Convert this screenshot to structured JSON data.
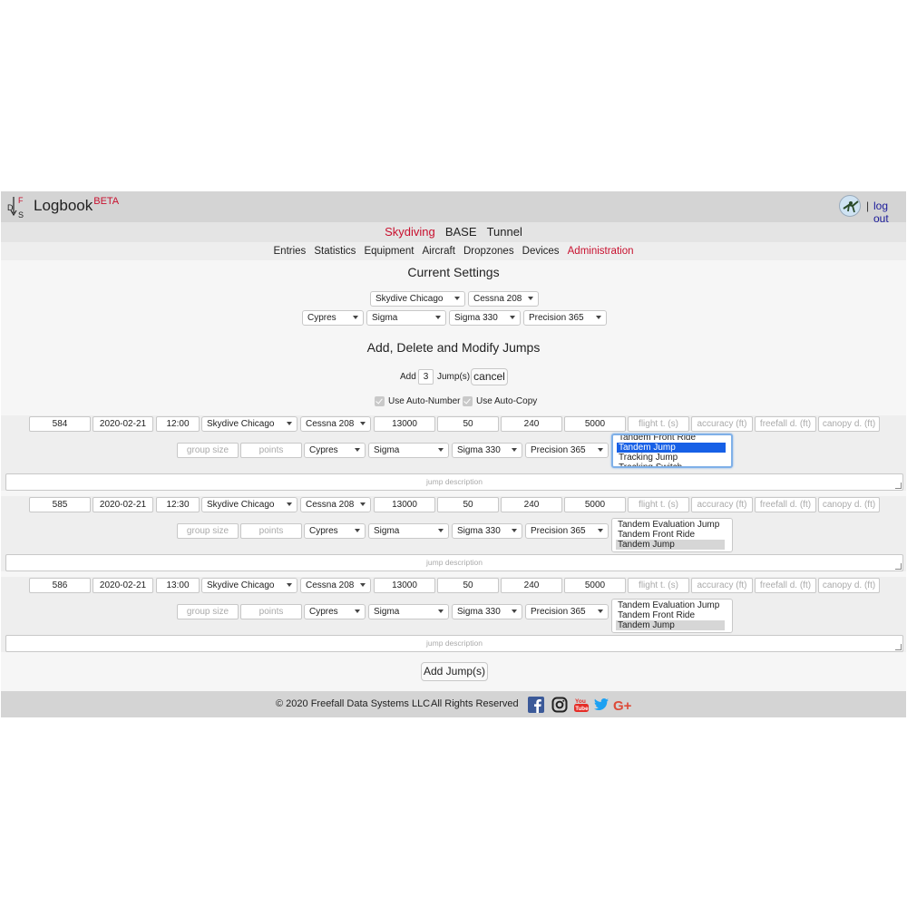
{
  "header": {
    "brand": "Logbook",
    "brand_sup": "BETA",
    "separator": "|",
    "logout_label": "log out"
  },
  "sport_tabs": [
    "Skydiving",
    "BASE",
    "Tunnel"
  ],
  "nav_tabs": [
    "Entries",
    "Statistics",
    "Equipment",
    "Aircraft",
    "Dropzones",
    "Devices",
    "Administration"
  ],
  "current_settings": {
    "title": "Current Settings",
    "dropzone": "Skydive Chicago",
    "aircraft": "Cessna 208",
    "aad": "Cypres",
    "container": "Sigma",
    "main": "Sigma 330",
    "reserve": "Precision 365"
  },
  "jumps_section": {
    "title": "Add, Delete and Modify Jumps",
    "add_label": "Add",
    "add_count": "3",
    "jumps_label": "Jump(s)",
    "cancel_label": "cancel",
    "auto_number_label": "Use Auto-Number",
    "auto_copy_label": "Use Auto-Copy",
    "add_button_label": "Add Jump(s)"
  },
  "placeholders": {
    "flight_time": "flight t. (s)",
    "accuracy": "accuracy (ft)",
    "freefall": "freefall d. (ft)",
    "canopy": "canopy d. (ft)",
    "group_size": "group size",
    "points": "points",
    "description": "jump description"
  },
  "jumps": [
    {
      "number": "584",
      "date": "2020-02-21",
      "time": "12:00",
      "dropzone": "Skydive Chicago",
      "aircraft": "Cessna 208",
      "altitude": "13000",
      "freefall_time": "50",
      "canopy_time": "240",
      "deploy": "5000",
      "aad": "Cypres",
      "container": "Sigma",
      "main": "Sigma 330",
      "reserve": "Precision 365",
      "types": [
        "Tandem Front Ride",
        "Tandem Jump",
        "Tracking Jump",
        "Tracking Switch"
      ],
      "selected_index": 1
    },
    {
      "number": "585",
      "date": "2020-02-21",
      "time": "12:30",
      "dropzone": "Skydive Chicago",
      "aircraft": "Cessna 208",
      "altitude": "13000",
      "freefall_time": "50",
      "canopy_time": "240",
      "deploy": "5000",
      "aad": "Cypres",
      "container": "Sigma",
      "main": "Sigma 330",
      "reserve": "Precision 365",
      "types": [
        "Tandem Evaluation Jump",
        "Tandem Front Ride",
        "Tandem Jump"
      ],
      "selected_index": 2
    },
    {
      "number": "586",
      "date": "2020-02-21",
      "time": "13:00",
      "dropzone": "Skydive Chicago",
      "aircraft": "Cessna 208",
      "altitude": "13000",
      "freefall_time": "50",
      "canopy_time": "240",
      "deploy": "5000",
      "aad": "Cypres",
      "container": "Sigma",
      "main": "Sigma 330",
      "reserve": "Precision 365",
      "types": [
        "Tandem Evaluation Jump",
        "Tandem Front Ride",
        "Tandem Jump"
      ],
      "selected_index": 2
    }
  ],
  "footer": {
    "copyright": "© 2020 Freefall Data Systems LLC",
    "rights": "All Rights Reserved",
    "social_icons": [
      "facebook-icon",
      "instagram-icon",
      "youtube-icon",
      "twitter-icon",
      "google-plus-icon"
    ],
    "colors": {
      "facebook": "#3b5998",
      "youtube": "#e52d27",
      "twitter": "#1da1f2",
      "google_plus": "#dd4b39"
    }
  },
  "colors": {
    "accent_red": "#c8102e",
    "selection_blue": "#1760e6",
    "header_gray": "#d4d4d4"
  }
}
